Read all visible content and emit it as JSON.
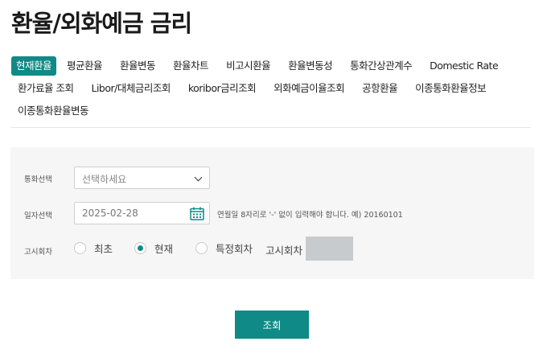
{
  "page": {
    "title": "환율/외화예금 금리"
  },
  "tabs": {
    "row1": [
      {
        "label": "현재환율",
        "active": true
      },
      {
        "label": "평균환율"
      },
      {
        "label": "환율변동"
      },
      {
        "label": "환율차트"
      },
      {
        "label": "비고시환율"
      },
      {
        "label": "환율변동성"
      },
      {
        "label": "통화간상관계수"
      },
      {
        "label": "Domestic Rate"
      }
    ],
    "row2": [
      {
        "label": "환가료율 조회"
      },
      {
        "label": "Libor/대체금리조회"
      },
      {
        "label": "koribor금리조회"
      },
      {
        "label": "외화예금이율조회"
      },
      {
        "label": "공항환율"
      },
      {
        "label": "이종통화환율정보"
      }
    ],
    "row3": [
      {
        "label": "이종통화환율변동"
      }
    ]
  },
  "form": {
    "currency": {
      "label": "통화선택",
      "value": "선택하세요"
    },
    "date": {
      "label": "일자선택",
      "value": "2025-02-28",
      "hint": "연월일 8자리로 '-' 없이 입력해야 합니다. 예) 20160101"
    },
    "notice": {
      "label": "고시회차",
      "options": [
        {
          "label": "최초",
          "checked": false
        },
        {
          "label": "현재",
          "checked": true
        },
        {
          "label": "특정회차",
          "checked": false
        }
      ],
      "round_label": "고시회차",
      "round_value": ""
    }
  },
  "actions": {
    "search_label": "조회"
  },
  "colors": {
    "accent": "#0f8a86",
    "panel_bg": "#f6f6f6",
    "disabled_input": "#c8cbce"
  }
}
